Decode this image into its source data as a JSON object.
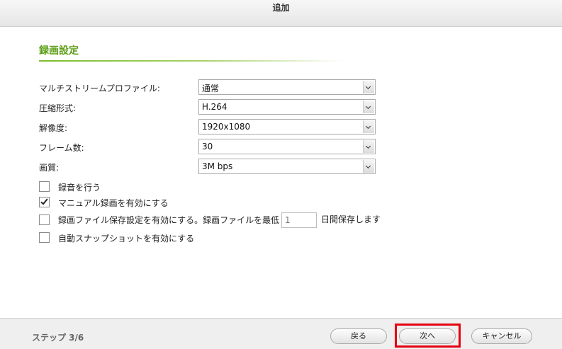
{
  "dialog": {
    "title": "追加"
  },
  "section": {
    "title": "録画設定"
  },
  "fields": [
    {
      "label": "マルチストリームプロファイル:",
      "value": "通常"
    },
    {
      "label": "圧縮形式:",
      "value": "H.264"
    },
    {
      "label": "解像度:",
      "value": "1920x1080"
    },
    {
      "label": "フレーム数:",
      "value": "30"
    },
    {
      "label": "画質:",
      "value": "3M bps"
    }
  ],
  "options": [
    {
      "label": "録音を行う",
      "checked": false
    },
    {
      "label": "マニュアル録画を有効にする",
      "checked": true
    },
    {
      "label": "録画ファイル保存設定を有効にする。録画ファイルを最低",
      "checked": false
    },
    {
      "label": "自動スナップショットを有効にする",
      "checked": false
    }
  ],
  "retention": {
    "placeholder": "1",
    "suffix": "日間保存します"
  },
  "footer": {
    "step": "ステップ 3/6",
    "back_label": "戻る",
    "next_label": "次へ",
    "cancel_label": "キャンセル"
  },
  "colors": {
    "accent": "#5a9e14",
    "highlight": "#e50010"
  }
}
